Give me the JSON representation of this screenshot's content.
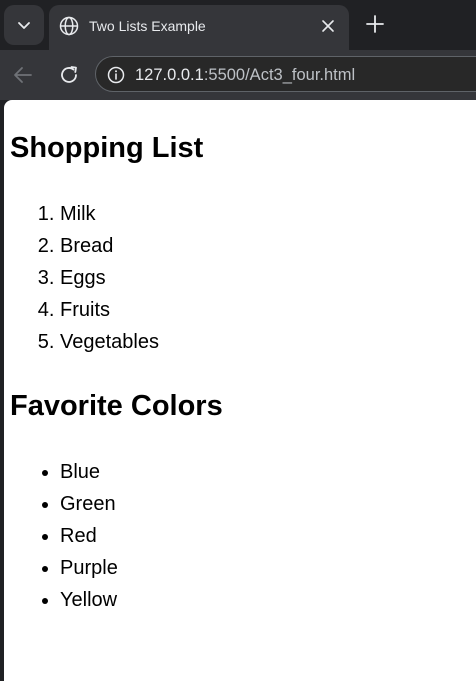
{
  "browser": {
    "tab_title": "Two Lists Example",
    "url_host": "127.0.0.1",
    "url_rest": ":5500/Act3_four.html"
  },
  "page": {
    "shopping_heading": "Shopping List",
    "shopping_items": [
      "Milk",
      "Bread",
      "Eggs",
      "Fruits",
      "Vegetables"
    ],
    "colors_heading": "Favorite Colors",
    "color_items": [
      "Blue",
      "Green",
      "Red",
      "Purple",
      "Yellow"
    ]
  }
}
